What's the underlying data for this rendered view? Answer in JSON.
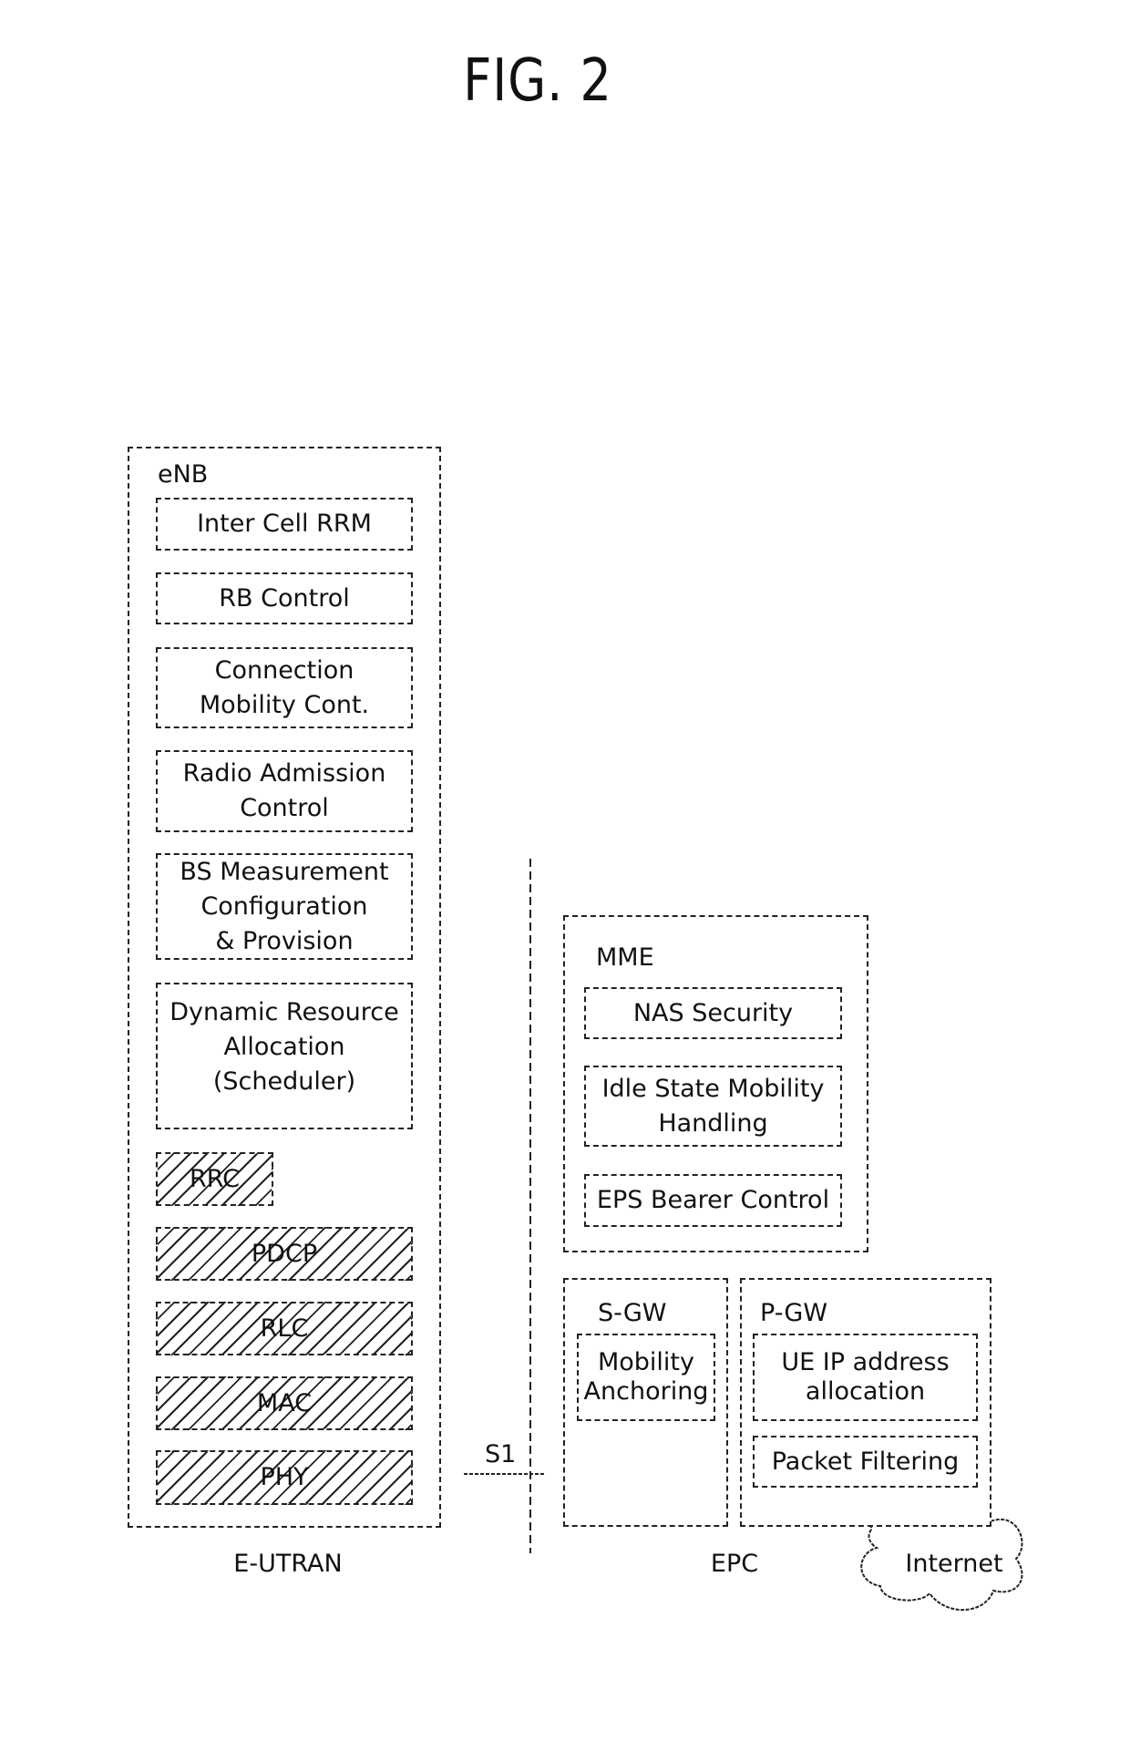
{
  "figure": {
    "title": "FIG. 2"
  },
  "eutran": {
    "group_label": "E-UTRAN",
    "enb": {
      "label": "eNB",
      "functions": [
        "Inter Cell RRM",
        "RB Control",
        "Connection\nMobility Cont.",
        "Radio Admission\nControl",
        "BS Measurement\nConfiguration\n& Provision",
        "Dynamic Resource\nAllocation\n(Scheduler)"
      ],
      "protocol_layers": [
        "RRC",
        "PDCP",
        "RLC",
        "MAC",
        "PHY"
      ]
    }
  },
  "interface": {
    "label": "S1"
  },
  "epc": {
    "group_label": "EPC",
    "mme": {
      "label": "MME",
      "functions": [
        "NAS Security",
        "Idle State Mobility\nHandling",
        "EPS Bearer Control"
      ]
    },
    "sgw": {
      "label": "S-GW",
      "functions": [
        "Mobility\nAnchoring"
      ]
    },
    "pgw": {
      "label": "P-GW",
      "functions": [
        "UE IP address\nallocation",
        "Packet Filtering"
      ]
    }
  },
  "internet": {
    "label": "Internet"
  }
}
